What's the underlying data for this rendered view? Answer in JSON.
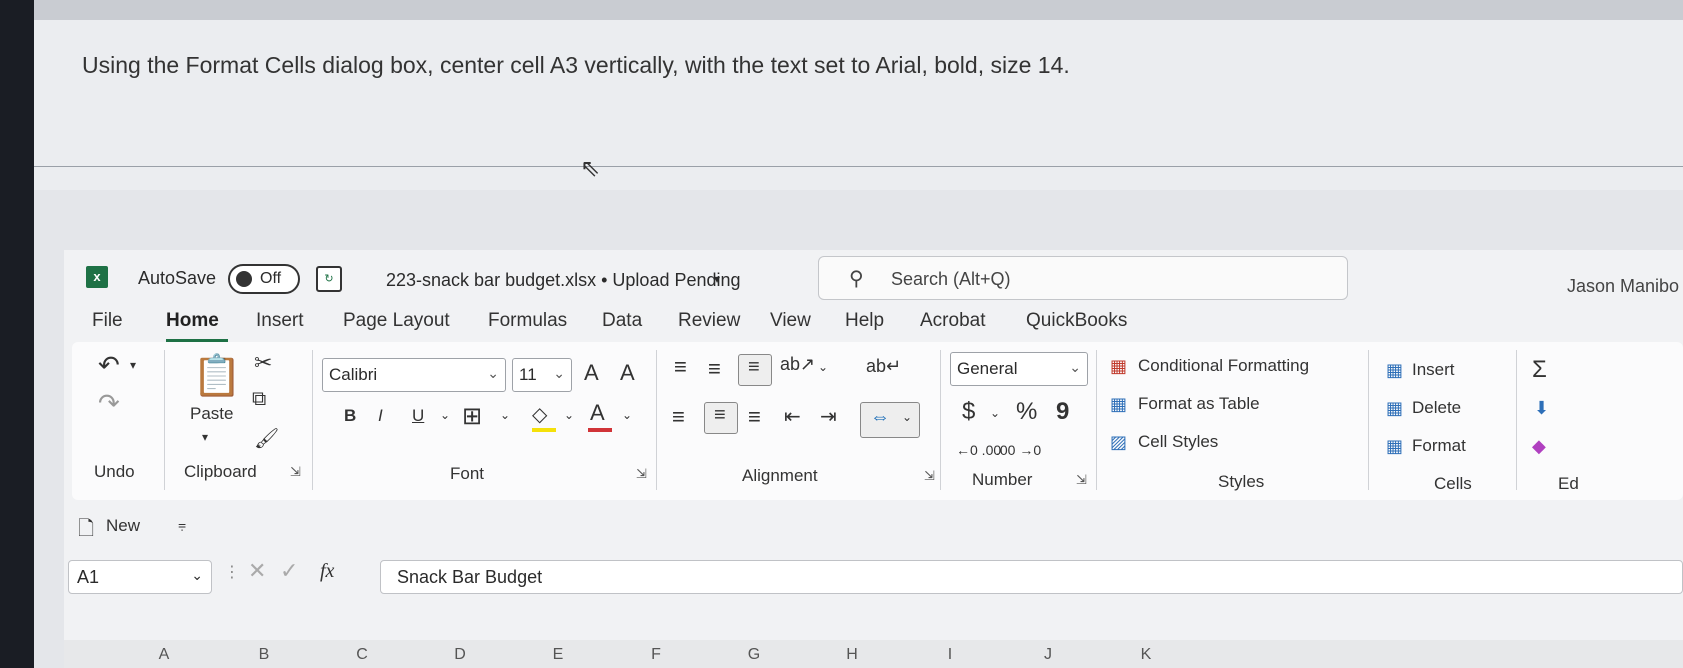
{
  "question": "Using the Format Cells dialog box, center cell A3 vertically, with the text set to Arial, bold, size 14.",
  "titlebar": {
    "autosave_label": "AutoSave",
    "autosave_state": "Off",
    "document_title": "223-snack bar budget.xlsx • Upload Pending",
    "search_placeholder": "Search (Alt+Q)",
    "user_name": "Jason Manibo"
  },
  "tabs": [
    "File",
    "Home",
    "Insert",
    "Page Layout",
    "Formulas",
    "Data",
    "Review",
    "View",
    "Help",
    "Acrobat",
    "QuickBooks"
  ],
  "active_tab": "Home",
  "ribbon": {
    "undo_label": "Undo",
    "clipboard": {
      "paste_label": "Paste",
      "group_label": "Clipboard"
    },
    "font": {
      "font_name": "Calibri",
      "font_size": "11",
      "grow": "A",
      "shrink": "A",
      "bold": "B",
      "italic": "I",
      "underline": "U",
      "font_color": "A",
      "group_label": "Font"
    },
    "alignment": {
      "group_label": "Alignment"
    },
    "number": {
      "format": "General",
      "currency": "$",
      "percent": "%",
      "comma": "9",
      "group_label": "Number"
    },
    "styles": {
      "conditional": "Conditional Formatting",
      "format_table": "Format as Table",
      "cell_styles": "Cell Styles",
      "group_label": "Styles"
    },
    "cells": {
      "insert": "Insert",
      "delete": "Delete",
      "format": "Format",
      "group_label": "Cells"
    },
    "editing": {
      "sum": "Σ",
      "group_label": "Ed"
    }
  },
  "qat": {
    "new_label": "New"
  },
  "formula_bar": {
    "name_box": "A1",
    "fx": "fx",
    "content": "Snack Bar Budget"
  },
  "columns": [
    "A",
    "B",
    "C",
    "D",
    "E",
    "F",
    "G",
    "H",
    "I",
    "J",
    "K"
  ],
  "colors": {
    "excel_green": "#1e7145",
    "font_red": "#d13438",
    "highlight_yellow": "#f5e10a"
  }
}
